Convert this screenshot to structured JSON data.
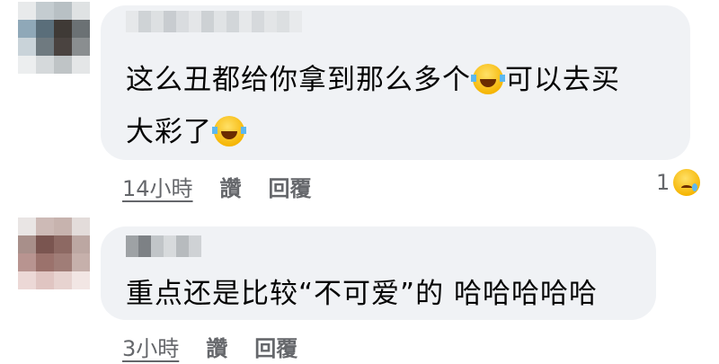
{
  "comments": [
    {
      "text_line1": "这么丑都给你拿到那么多个",
      "text_line1b": "可以去买",
      "text_line2": "大彩了",
      "time": "14小時",
      "like_label": "讚",
      "reply_label": "回覆",
      "reaction_count": "1",
      "inline_emoji": "laughing-tears-emoji",
      "reaction_emoji": "sad-emoji"
    },
    {
      "text": "重点还是比较“不可爱”的 哈哈哈哈哈",
      "time": "3小時",
      "like_label": "讚",
      "reply_label": "回覆"
    }
  ],
  "colors": {
    "bubble": "#f0f2f5",
    "text": "#050505",
    "meta": "#65676b"
  }
}
